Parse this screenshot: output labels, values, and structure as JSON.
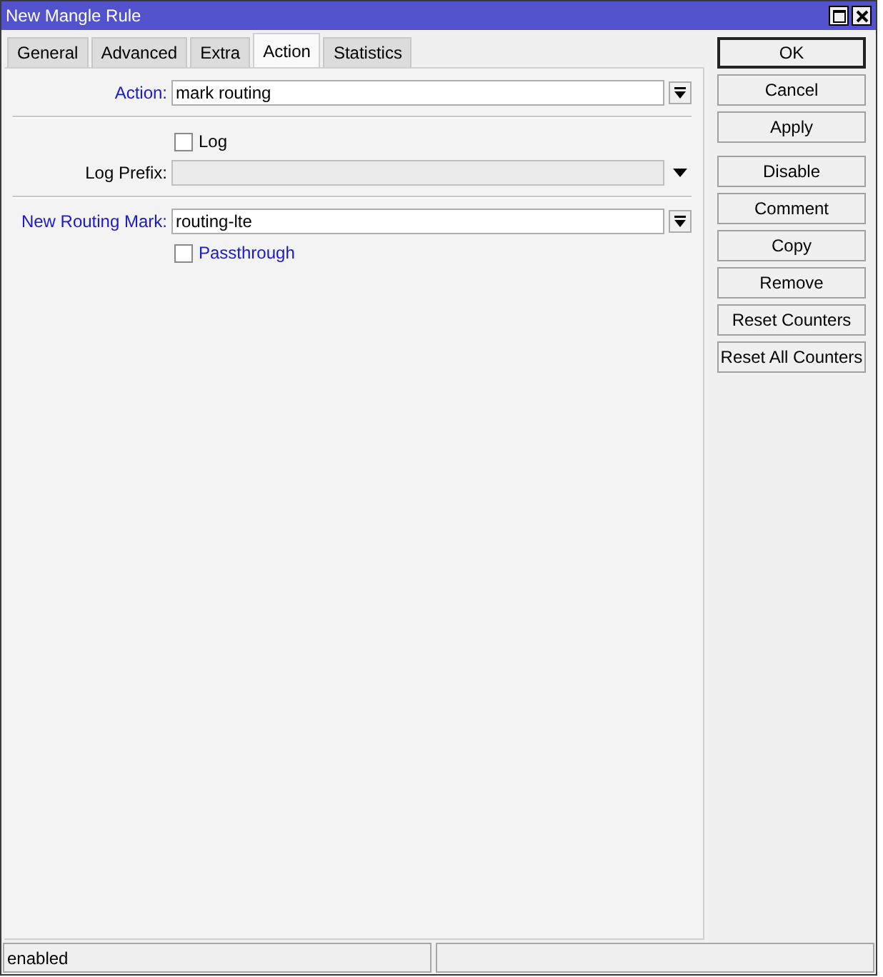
{
  "window": {
    "title": "New Mangle Rule"
  },
  "tabs": [
    {
      "label": "General",
      "selected": false
    },
    {
      "label": "Advanced",
      "selected": false
    },
    {
      "label": "Extra",
      "selected": false
    },
    {
      "label": "Action",
      "selected": true
    },
    {
      "label": "Statistics",
      "selected": false
    }
  ],
  "form": [
    {
      "kind": "combo",
      "label": "Action:",
      "highlighted": true,
      "value": "mark routing"
    },
    {
      "kind": "divider"
    },
    {
      "kind": "checkbox",
      "label": "Log",
      "highlighted": false,
      "checked": false
    },
    {
      "kind": "disabled-text",
      "label": "Log Prefix:",
      "highlighted": false
    },
    {
      "kind": "divider"
    },
    {
      "kind": "combo",
      "label": "New Routing Mark:",
      "highlighted": true,
      "value": "routing-lte"
    },
    {
      "kind": "checkbox",
      "label": "Passthrough",
      "highlighted": true,
      "checked": false
    }
  ],
  "button_groups": [
    [
      {
        "label": "OK",
        "default": true
      },
      {
        "label": "Cancel",
        "default": false
      },
      {
        "label": "Apply",
        "default": false
      }
    ],
    [
      {
        "label": "Disable",
        "default": false
      },
      {
        "label": "Comment",
        "default": false
      },
      {
        "label": "Copy",
        "default": false
      },
      {
        "label": "Remove",
        "default": false
      },
      {
        "label": "Reset Counters",
        "default": false
      },
      {
        "label": "Reset All Counters",
        "default": false
      }
    ]
  ],
  "status_bar": {
    "text": "enabled"
  }
}
